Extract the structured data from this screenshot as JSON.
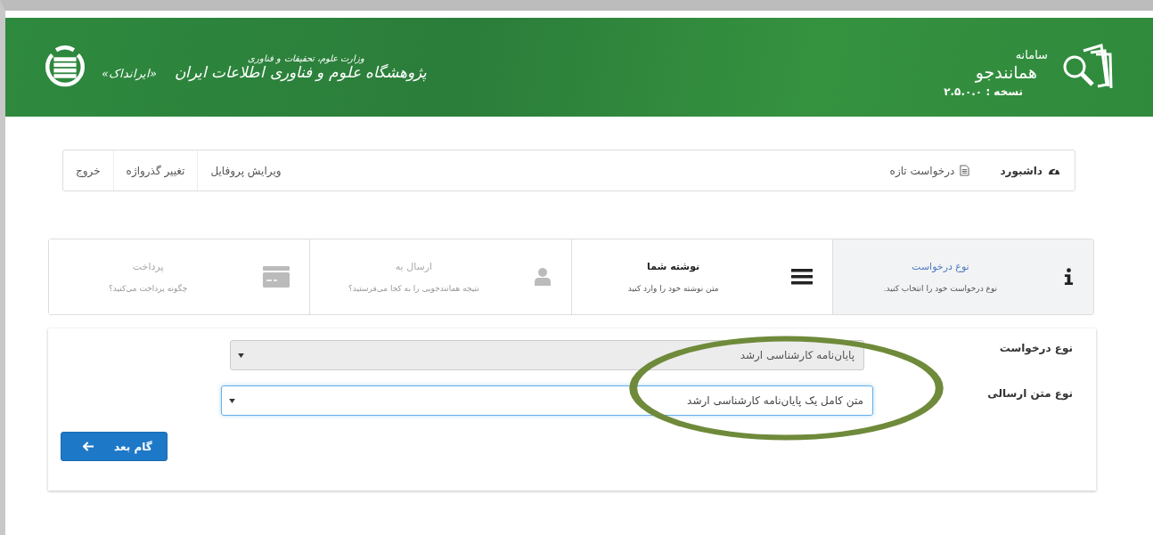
{
  "header": {
    "system_label": "سامانه",
    "system_name": "همانندجو",
    "version": "نسخه : ۲.۵.۰.۰",
    "ministry": "وزارت علوم، تحقیقات و فناوری",
    "institute": "پژوهشگاه علوم و فناوری اطلاعات ایران",
    "institute_short": "«ایرانداک»"
  },
  "nav": {
    "items": [
      {
        "label": "داشبورد",
        "kind": "dashboard"
      },
      {
        "label": "درخواست تازه",
        "kind": "document"
      }
    ],
    "user_items": [
      {
        "label": "ویرایش پروفایل"
      },
      {
        "label": "تغییر گذرواژه"
      },
      {
        "label": "خروج"
      }
    ]
  },
  "steps": [
    {
      "title": "نوع درخواست",
      "subtitle": "نوع درخواست خود را انتخاب کنید.",
      "kind": "info",
      "selected": true,
      "disabled": false
    },
    {
      "title": "نوشته شما",
      "subtitle": "متن نوشته خود را وارد کنید",
      "kind": "list",
      "selected": false,
      "disabled": false
    },
    {
      "title": "ارسال به",
      "subtitle": "نتیجه همانندجویی را به کجا می‌فرستید؟",
      "kind": "user",
      "selected": false,
      "disabled": true
    },
    {
      "title": "پرداخت",
      "subtitle": "چگونه پرداخت می‌کنید؟",
      "kind": "card",
      "selected": false,
      "disabled": true
    }
  ],
  "form": {
    "fields": [
      {
        "label": "نوع درخواست",
        "value": "پایان‌نامه کارشناسی ارشد",
        "disabled": true,
        "focused": false
      },
      {
        "label": "نوع متن ارسالی",
        "value": "متن کامل یک پایان‌نامه کارشناسی ارشد",
        "disabled": false,
        "focused": true
      }
    ],
    "next_button": "گام بعد"
  },
  "annotation": {
    "kind": "ellipse",
    "color": "#6f8a3a"
  }
}
